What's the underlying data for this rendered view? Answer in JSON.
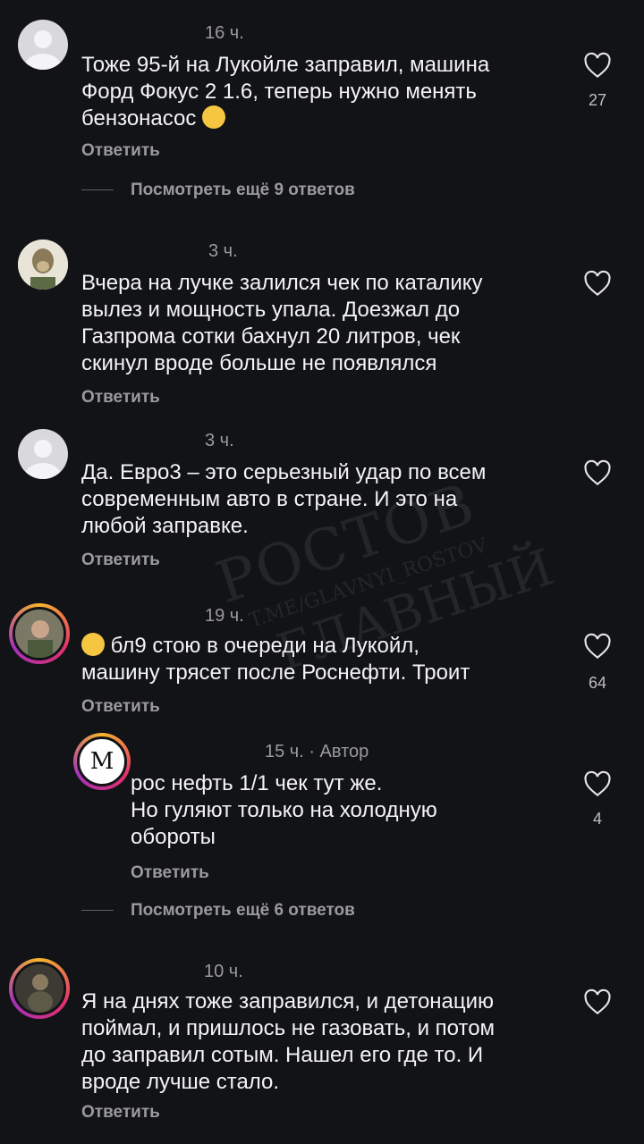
{
  "comments": [
    {
      "time": "16 ч.",
      "text": "Тоже 95-й на Лукойле заправил, машина\nФорд Фокус 2 1.6, теперь нужно менять\nбензонасос",
      "reply": "Ответить",
      "likes": "27",
      "more": "Посмотреть ещё 9 ответов"
    },
    {
      "time": "3 ч.",
      "text": "Вчера на лучке залился чек по каталику\nвылез и мощность упала. Доезжал до\nГазпрома сотки бахнул 20 литров, чек\nскинул вроде больше не появлялся",
      "reply": "Ответить"
    },
    {
      "time": "3 ч.",
      "text": "Да. Евро3 – это серьезный удар по всем\nсовременным авто в стране. И это на\nлюбой заправке.",
      "reply": "Ответить"
    },
    {
      "time": "19 ч.",
      "text": "бл9 стою в очереди на Лукойл,\nмашину трясет после Роснефти. Троит",
      "reply": "Ответить",
      "likes": "64"
    },
    {
      "time": "15 ч. · Автор",
      "text": "рос нефть 1/1 чек тут же.\nНо гуляют только на холодную\nобороты",
      "reply": "Ответить",
      "likes": "4",
      "more": "Посмотреть ещё 6 ответов",
      "avatar_letter": "M"
    },
    {
      "time": "10 ч.",
      "text": "Я на днях тоже заправился, и детонацию\nпоймал, и пришлось не газовать, и потом\nдо заправил сотым. Нашел его где то. И\nвроде лучше стало.",
      "reply": "Ответить"
    }
  ],
  "watermark": {
    "line1": "РОСТОВ",
    "line2": "T.ME/GLAVNYI_ROSTOV",
    "line3": "ГЛАВНЫЙ"
  }
}
